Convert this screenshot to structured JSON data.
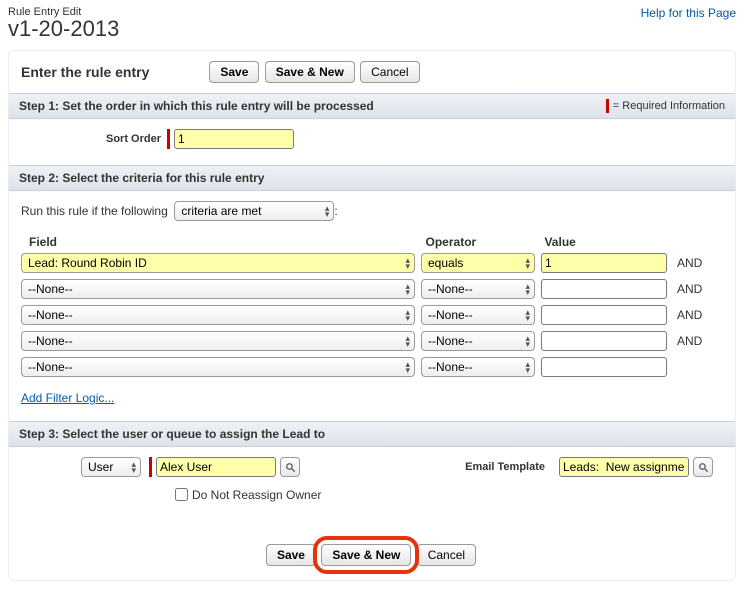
{
  "header": {
    "small_title": "Rule Entry Edit",
    "big_title": "v1-20-2013",
    "help_link": "Help for this Page"
  },
  "main": {
    "title": "Enter the rule entry",
    "buttons": {
      "save": "Save",
      "save_new": "Save & New",
      "cancel": "Cancel"
    }
  },
  "step1": {
    "title": "Step 1: Set the order in which this rule entry will be processed",
    "required_note": "= Required Information",
    "sort_order_label": "Sort Order",
    "sort_order_value": "1"
  },
  "step2": {
    "title": "Step 2: Select the criteria for this rule entry",
    "run_prefix": "Run this rule if the following",
    "run_mode": "criteria are met",
    "colon": ":",
    "cols": {
      "field": "Field",
      "operator": "Operator",
      "value": "Value"
    },
    "and": "AND",
    "rows": [
      {
        "field": "Lead: Round Robin ID",
        "op": "equals",
        "val": "1",
        "highlight": true,
        "show_and": true
      },
      {
        "field": "--None--",
        "op": "--None--",
        "val": "",
        "highlight": false,
        "show_and": true
      },
      {
        "field": "--None--",
        "op": "--None--",
        "val": "",
        "highlight": false,
        "show_and": true
      },
      {
        "field": "--None--",
        "op": "--None--",
        "val": "",
        "highlight": false,
        "show_and": true
      },
      {
        "field": "--None--",
        "op": "--None--",
        "val": "",
        "highlight": false,
        "show_and": false
      }
    ],
    "filter_logic": "Add Filter Logic..."
  },
  "step3": {
    "title": "Step 3: Select the user or queue to assign the Lead to",
    "type": "User",
    "assignee": "Alex User",
    "dnr_label": "Do Not Reassign Owner",
    "dnr_checked": false,
    "email_template_label": "Email Template",
    "email_template_value": "Leads:  New assignme"
  },
  "bottom": {
    "buttons": {
      "save": "Save",
      "save_new": "Save & New",
      "cancel": "Cancel"
    }
  }
}
